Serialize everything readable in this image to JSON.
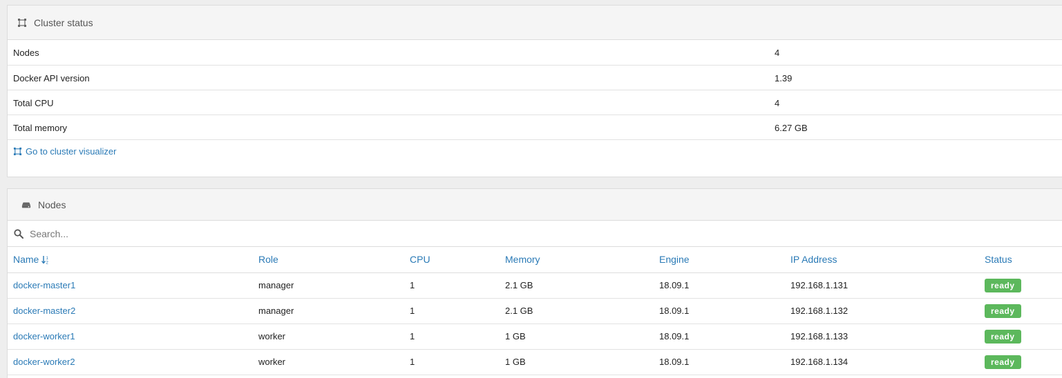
{
  "cluster_status": {
    "title": "Cluster status",
    "rows": [
      {
        "key": "Nodes",
        "value": "4"
      },
      {
        "key": "Docker API version",
        "value": "1.39"
      },
      {
        "key": "Total CPU",
        "value": "4"
      },
      {
        "key": "Total memory",
        "value": "6.27 GB"
      }
    ],
    "visualizer_link": "Go to cluster visualizer"
  },
  "nodes": {
    "title": "Nodes",
    "search_placeholder": "Search...",
    "columns": [
      "Name",
      "Role",
      "CPU",
      "Memory",
      "Engine",
      "IP Address",
      "Status"
    ],
    "rows": [
      {
        "name": "docker-master1",
        "role": "manager",
        "cpu": "1",
        "memory": "2.1 GB",
        "engine": "18.09.1",
        "ip": "192.168.1.131",
        "status": "ready"
      },
      {
        "name": "docker-master2",
        "role": "manager",
        "cpu": "1",
        "memory": "2.1 GB",
        "engine": "18.09.1",
        "ip": "192.168.1.132",
        "status": "ready"
      },
      {
        "name": "docker-worker1",
        "role": "worker",
        "cpu": "1",
        "memory": "1 GB",
        "engine": "18.09.1",
        "ip": "192.168.1.133",
        "status": "ready"
      },
      {
        "name": "docker-worker2",
        "role": "worker",
        "cpu": "1",
        "memory": "1 GB",
        "engine": "18.09.1",
        "ip": "192.168.1.134",
        "status": "ready"
      }
    ]
  },
  "icons": {
    "cluster": "cluster-icon",
    "nodes": "hdd-icon",
    "search": "search-icon",
    "sort": "sort-alpha-icon"
  },
  "colors": {
    "link": "#2a7ab6",
    "ready_badge": "#5cb85c",
    "panel_heading_bg": "#f5f5f5"
  }
}
